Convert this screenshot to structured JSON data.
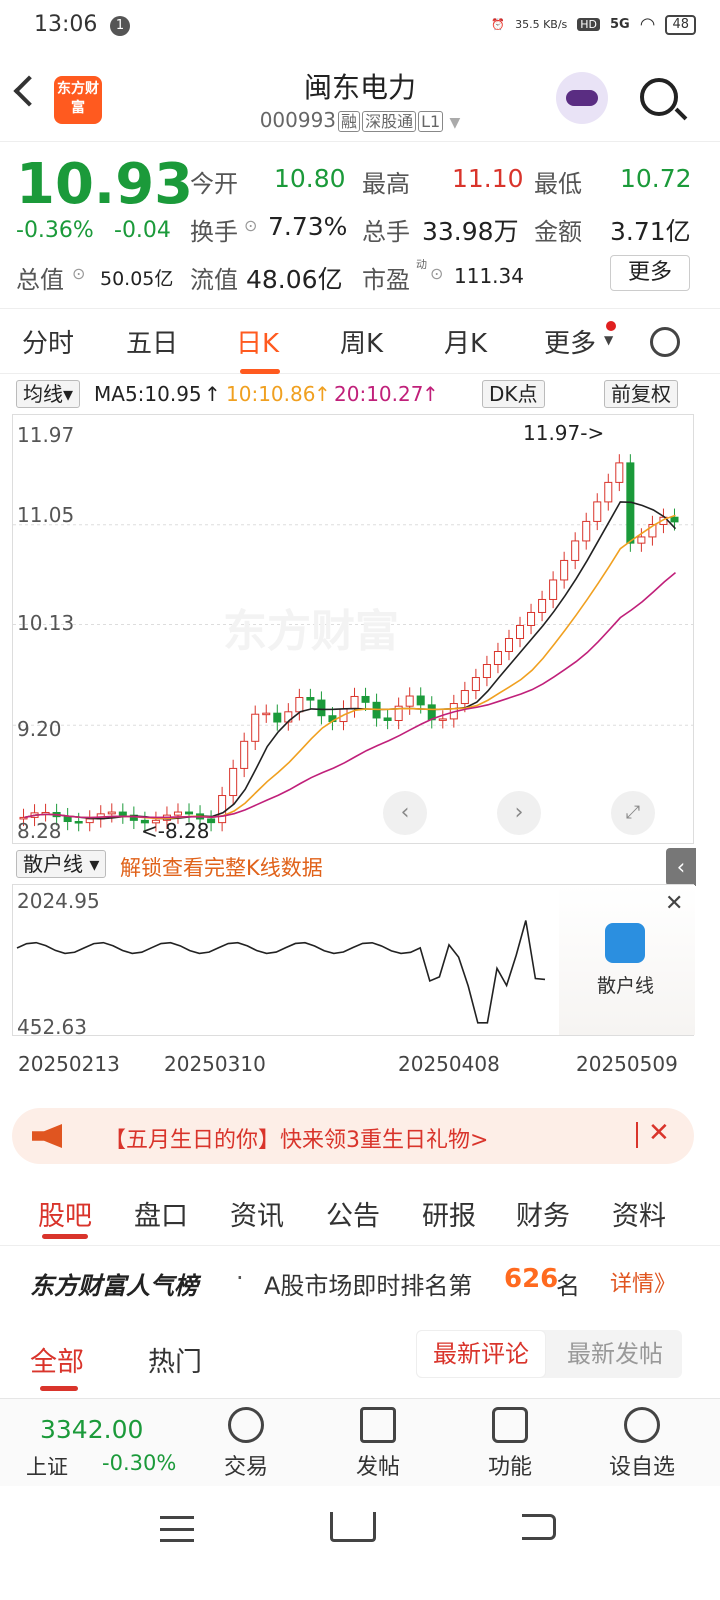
{
  "status": {
    "time": "13:06",
    "notif": "1",
    "speed": "35.5 KB/s",
    "hd": "HD",
    "net": "5G",
    "battery": "48"
  },
  "header": {
    "logo": "东方财富",
    "name": "闽东电力",
    "code": "000993",
    "tag1": "融",
    "tag2": "深股通",
    "tag3": "L1"
  },
  "quote": {
    "price": "10.93",
    "change_pct": "-0.36%",
    "change": "-0.04",
    "open_label": "今开",
    "open": "10.80",
    "high_label": "最高",
    "high": "11.10",
    "low_label": "最低",
    "low": "10.72",
    "turnover_label": "换手",
    "turnover": "7.73%",
    "volume_label": "总手",
    "volume": "33.98万",
    "amount_label": "金额",
    "amount": "3.71亿",
    "mktcap_label": "总值",
    "mktcap": "50.05亿",
    "float_label": "流值",
    "float": "48.06亿",
    "pe_label": "市盈",
    "pe_sup": "动",
    "pe": "111.34",
    "more": "更多"
  },
  "tabs": [
    "分时",
    "五日",
    "日K",
    "周K",
    "月K",
    "更多"
  ],
  "chart": {
    "ma_select": "均线",
    "ma5": "MA5:10.95",
    "ma10": "10:10.86",
    "ma20": "20:10.27",
    "dk": "DK点",
    "adjust": "前复权",
    "y_labels": [
      "11.97",
      "11.05",
      "10.13",
      "9.20",
      "8.28"
    ],
    "max_label": "11.97->",
    "min_label": "<-8.28",
    "watermark": "东方财富",
    "retail_select": "散户线",
    "unlock": "解锁查看完整K线数据",
    "sub_top": "2024.95",
    "sub_bottom": "452.63",
    "sub_badge": "散户线",
    "dates": [
      "20250213",
      "20250310",
      "20250408",
      "20250509"
    ],
    "colors": {
      "up": "#d9342b",
      "down": "#1b9a3a",
      "ma5": "#222222",
      "ma10": "#f0a020",
      "ma20": "#c0207a"
    }
  },
  "chart_data": {
    "type": "candlestick",
    "title": "",
    "series": [
      {
        "name": "MA5",
        "value": 10.95
      },
      {
        "name": "10",
        "value": 10.86
      },
      {
        "name": "20",
        "value": 10.27
      }
    ],
    "y_ticks": [
      11.97,
      11.05,
      10.13,
      9.2,
      8.28
    ],
    "ylim": [
      8.28,
      11.97
    ],
    "high": 11.97,
    "low": 8.28,
    "x_ticks": [
      "20250213",
      "20250310",
      "20250408",
      "20250509"
    ]
  },
  "banner": {
    "text": "【五月生日的你】快来领3重生日礼物>"
  },
  "sections": [
    "股吧",
    "盘口",
    "资讯",
    "公告",
    "研报",
    "财务",
    "资料"
  ],
  "popularity": {
    "brand": "东方财富人气榜",
    "dot": "·",
    "pre": "A股市场即时排名第",
    "rank": "626",
    "post": "名",
    "detail": "详情》"
  },
  "filter": {
    "all": "全部",
    "hot": "热门",
    "latest_comment": "最新评论",
    "latest_post": "最新发帖"
  },
  "bottom": {
    "index_value": "3342.00",
    "index_name": "上证",
    "index_change": "-0.30%",
    "trade": "交易",
    "post": "发帖",
    "func": "功能",
    "watch": "设自选"
  }
}
